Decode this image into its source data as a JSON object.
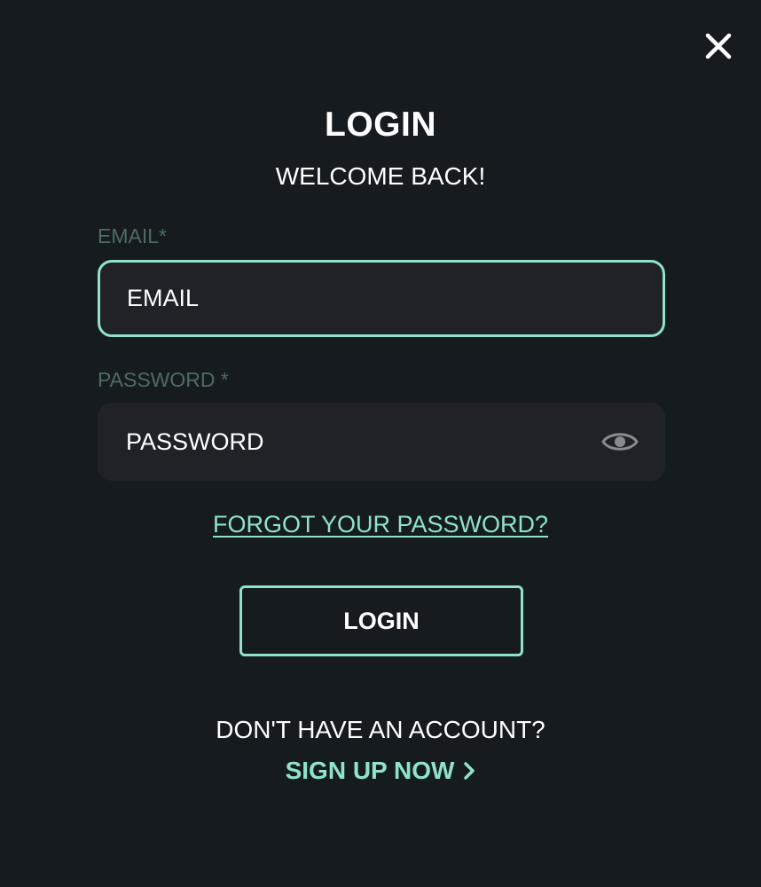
{
  "modal": {
    "title": "LOGIN",
    "subtitle": "WELCOME BACK!"
  },
  "form": {
    "email_label": "EMAIL*",
    "email_placeholder": "EMAIL",
    "password_label": "PASSWORD *",
    "password_placeholder": "PASSWORD",
    "forgot_link": "FORGOT YOUR PASSWORD?",
    "login_button": "LOGIN"
  },
  "footer": {
    "no_account_text": "DON'T HAVE AN ACCOUNT?",
    "signup_link": "SIGN UP NOW"
  },
  "icons": {
    "close": "close-icon",
    "show_password": "eye-icon",
    "signup_arrow": "chevron-right-icon"
  },
  "colors": {
    "background": "#151b1e",
    "accent": "#8fe3c8",
    "input_background": "#212228",
    "label": "#4f6b62",
    "text": "#ffffff"
  }
}
